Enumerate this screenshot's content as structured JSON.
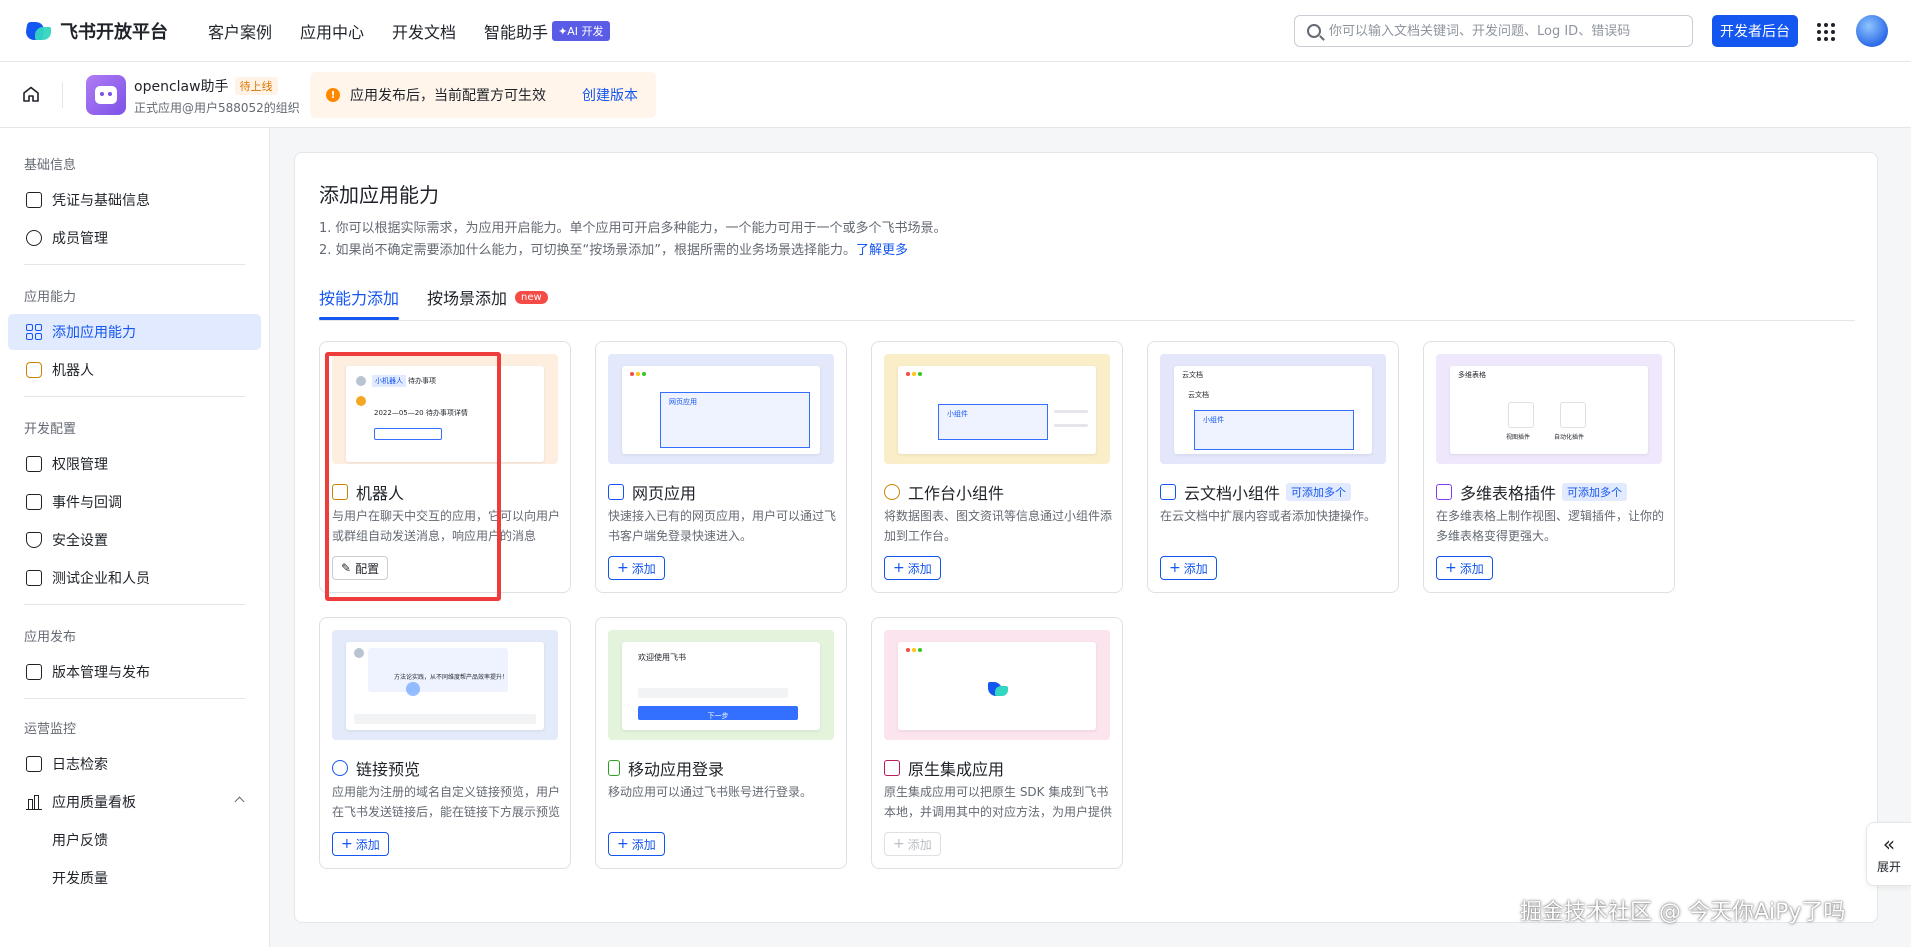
{
  "header": {
    "logo_text": "飞书开放平台",
    "nav": [
      "客户案例",
      "应用中心",
      "开发文档",
      "智能助手"
    ],
    "ai_badge": "✦AI 开发",
    "search_placeholder": "你可以输入文档关键词、开发问题、Log ID、错误码",
    "dev_console": "开发者后台"
  },
  "app": {
    "name": "openclaw助手",
    "status": "待上线",
    "subtitle": "正式应用@用户588052的组织",
    "notice": "应用发布后，当前配置方可生效",
    "notice_link": "创建版本"
  },
  "sidebar": {
    "groups": [
      "基础信息",
      "应用能力",
      "开发配置",
      "应用发布",
      "运营监控"
    ],
    "items": [
      {
        "label": "凭证与基础信息"
      },
      {
        "label": "成员管理"
      },
      {
        "label": "添加应用能力"
      },
      {
        "label": "机器人"
      },
      {
        "label": "权限管理"
      },
      {
        "label": "事件与回调"
      },
      {
        "label": "安全设置"
      },
      {
        "label": "测试企业和人员"
      },
      {
        "label": "版本管理与发布"
      },
      {
        "label": "日志检索"
      },
      {
        "label": "应用质量看板"
      },
      {
        "label": "用户反馈"
      },
      {
        "label": "开发质量"
      }
    ]
  },
  "main": {
    "title": "添加应用能力",
    "desc1": "1. 你可以根据实际需求，为应用开启能力。单个应用可开启多种能力，一个能力可用于一个或多个飞书场景。",
    "desc2": "2. 如果尚不确定需要添加什么能力，可切换至“按场景添加”，根据所需的业务场景选择能力。",
    "desc2_link": "了解更多",
    "tabs": [
      "按能力添加",
      "按场景添加"
    ],
    "new_badge": "new",
    "multi_badge": "可添加多个",
    "cards": [
      {
        "title": "机器人",
        "desc": "与用户在聊天中交互的应用，它可以向用户或群组自动发送消息，响应用户的消息",
        "button": "配置",
        "bg": "#fdeee0",
        "icon_color": "#c78400"
      },
      {
        "title": "网页应用",
        "desc": "快速接入已有的网页应用，用户可以通过飞书客户端免登录快速进入。",
        "button": "添加",
        "bg": "#e3e9fb",
        "icon_color": "#1456f0"
      },
      {
        "title": "工作台小组件",
        "desc": "将数据图表、图文资讯等信息通过小组件添加到工作台。",
        "button": "添加",
        "bg": "#faeec9",
        "icon_color": "#c78400"
      },
      {
        "title": "云文档小组件",
        "desc": "在云文档中扩展内容或者添加快捷操作。",
        "button": "添加",
        "bg": "#e4e7fb",
        "icon_color": "#1456f0"
      },
      {
        "title": "多维表格插件",
        "desc": "在多维表格上制作视图、逻辑插件，让你的多维表格变得更强大。",
        "button": "添加",
        "bg": "#efe7fb",
        "icon_color": "#7f3bf5"
      },
      {
        "title": "链接预览",
        "desc": "应用能为注册的域名自定义链接预览，用户在飞书发送链接后，能在链接下方展示预览卡片",
        "button": "添加",
        "bg": "#e3ebfb",
        "icon_color": "#1456f0"
      },
      {
        "title": "移动应用登录",
        "desc": "移动应用可以通过飞书账号进行登录。",
        "button": "添加",
        "bg": "#e3f3dc",
        "icon_color": "#2ea121"
      },
      {
        "title": "原生集成应用",
        "desc": "原生集成应用可以把原生 SDK 集成到飞书本地，并调用其中的对应方法，为用户提供服务",
        "button": "添加",
        "bg": "#fce4ee",
        "icon_color": "#b81d5e"
      }
    ],
    "mock_labels": {
      "bot_chip": "小机器人",
      "bot_todo": "待办事项",
      "bot_date": "2022—05—20 待办事项详情",
      "web": "网页应用",
      "widget": "小组件",
      "doc_header": "云文档",
      "doc_title": "云文档",
      "doc_widget": "小组件",
      "base_header": "多维表格",
      "base_view": "视图插件",
      "base_auto": "自动化插件",
      "login_title": "欢迎使用飞书",
      "login_btn": "下一步",
      "link_msg": "方法论实践，从不同维度帮产品效率提升！"
    }
  },
  "expand_label": "展开",
  "watermark": "掘金技术社区 @ 今天你AiPy了吗"
}
